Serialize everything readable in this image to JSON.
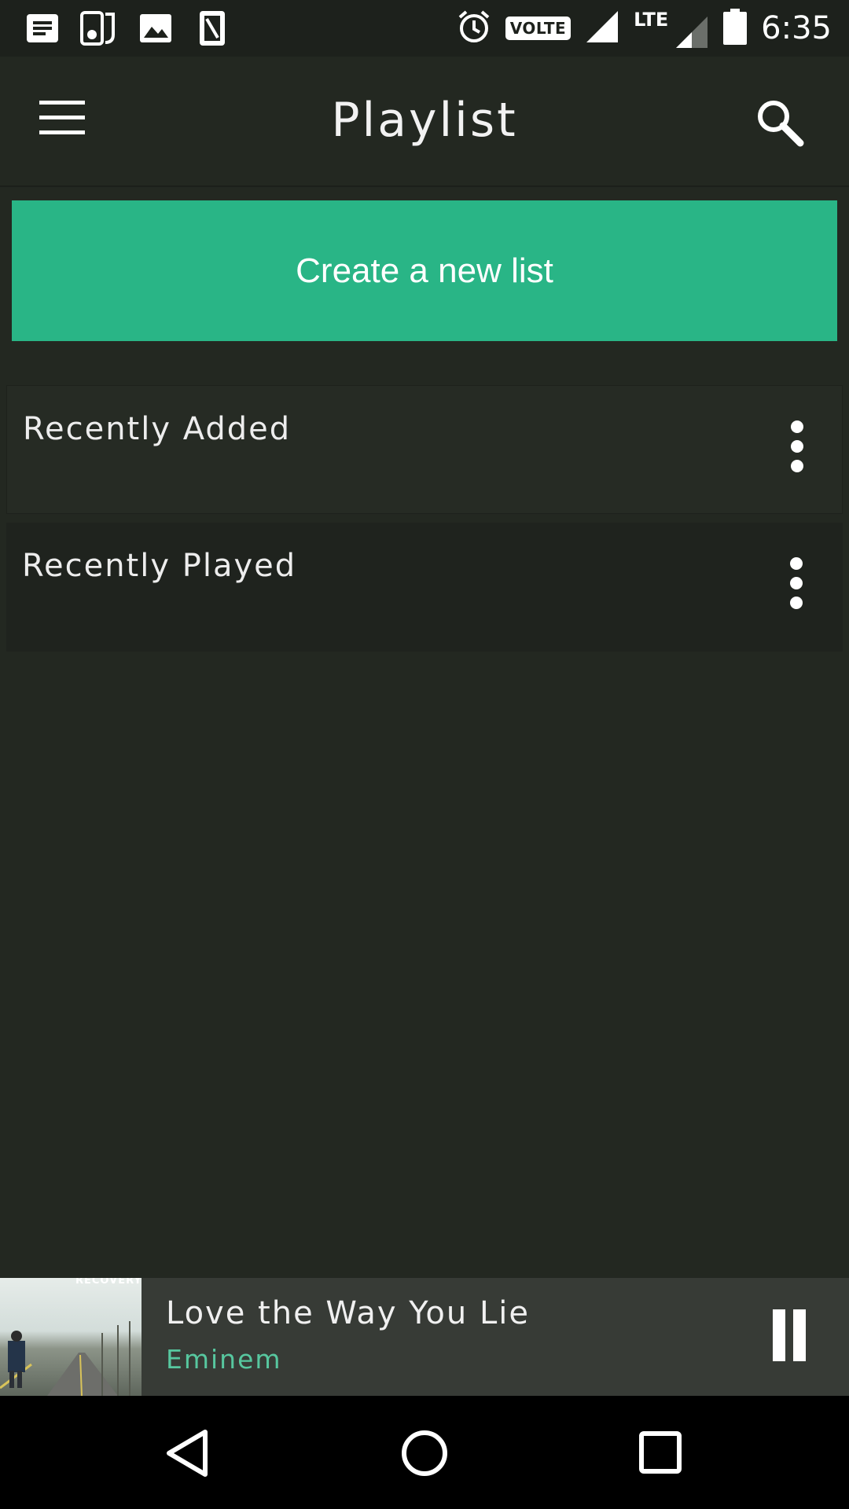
{
  "status_bar": {
    "icons": [
      "notification-doc-icon",
      "music-player-icon",
      "image-icon",
      "sim-card-icon"
    ],
    "volte_label": "VOLTE",
    "network_label": "LTE",
    "time": "6:35"
  },
  "app_bar": {
    "title": "Playlist",
    "menu_icon": "hamburger-menu-icon",
    "search_icon": "search-icon"
  },
  "create_button": {
    "label": "Create a new list",
    "color": "#29b586"
  },
  "playlists": [
    {
      "label": "Recently Added"
    },
    {
      "label": "Recently Played"
    }
  ],
  "now_playing": {
    "album_text": "RECOVERY",
    "title": "Love the Way You Lie",
    "artist": "Eminem",
    "artist_color": "#57c79f",
    "control_icon": "pause-icon"
  },
  "nav_bar": {
    "icons": [
      "back-icon",
      "home-icon",
      "recents-icon"
    ]
  }
}
